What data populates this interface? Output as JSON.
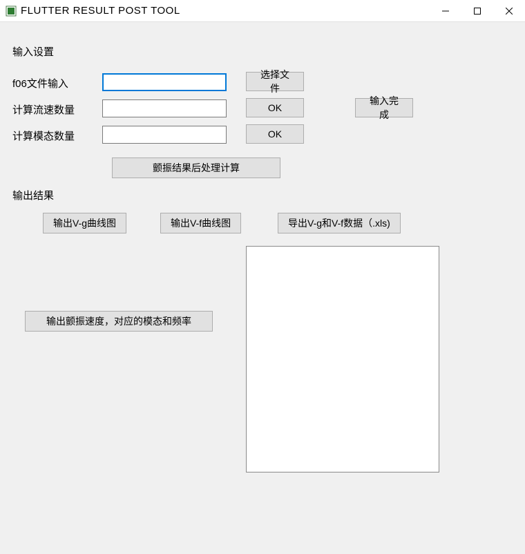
{
  "window": {
    "title": "FLUTTER RESULT POST TOOL"
  },
  "input_section": {
    "heading": "输入设置",
    "f06_label": "f06文件输入",
    "f06_value": "",
    "choose_file_btn": "选择文件",
    "velocity_count_label": "计算流速数量",
    "velocity_count_value": "",
    "velocity_ok_btn": "OK",
    "mode_count_label": "计算模态数量",
    "mode_count_value": "",
    "mode_ok_btn": "OK",
    "input_done_btn": "输入完成",
    "postprocess_btn": "颤振结果后处理计算"
  },
  "output_section": {
    "heading": "输出结果",
    "vg_curve_btn": "输出V-g曲线图",
    "vf_curve_btn": "输出V-f曲线图",
    "export_xls_btn": "导出V-g和V-f数据（.xls)",
    "flutter_detail_btn": "输出颤振速度，对应的模态和频率"
  }
}
